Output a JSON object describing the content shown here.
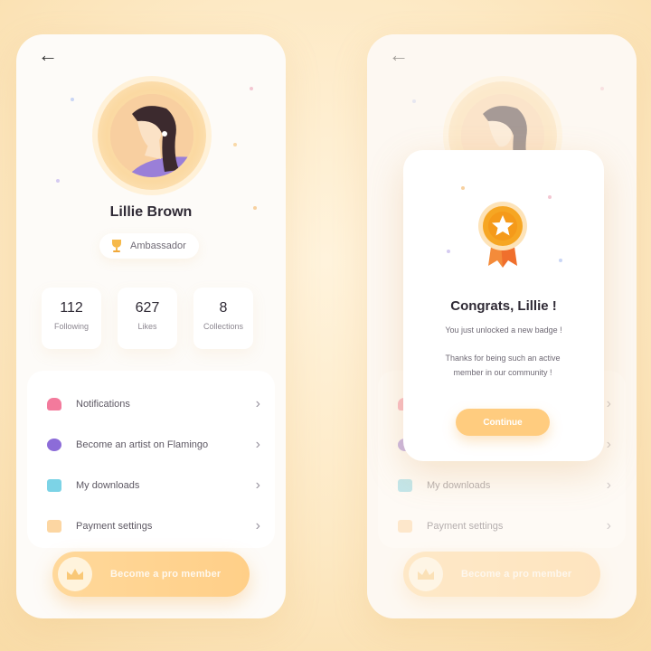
{
  "profile": {
    "name": "Lillie Brown",
    "badge": "Ambassador",
    "stats": [
      {
        "value": "112",
        "label": "Following"
      },
      {
        "value": "627",
        "label": "Likes"
      },
      {
        "value": "8",
        "label": "Collections"
      }
    ]
  },
  "menu": [
    {
      "label": "Notifications",
      "icon": "bell-icon",
      "color": "#f37a9c"
    },
    {
      "label": "Become an artist on Flamingo",
      "icon": "palette-icon",
      "color": "#8c6cd8"
    },
    {
      "label": "My downloads",
      "icon": "folder-icon",
      "color": "#7cd3e6"
    },
    {
      "label": "Payment settings",
      "icon": "card-icon",
      "color": "#fcd6a2"
    }
  ],
  "pro_button": {
    "label": "Become a pro member"
  },
  "modal": {
    "title": "Congrats, Lillie !",
    "subtitle": "You just unlocked a new badge !",
    "body": "Thanks for being such an active member in our community !",
    "button": "Continue"
  },
  "colors": {
    "accent": "#ffcc7f",
    "medal": "#f6a623",
    "background": "#fde9c4"
  }
}
